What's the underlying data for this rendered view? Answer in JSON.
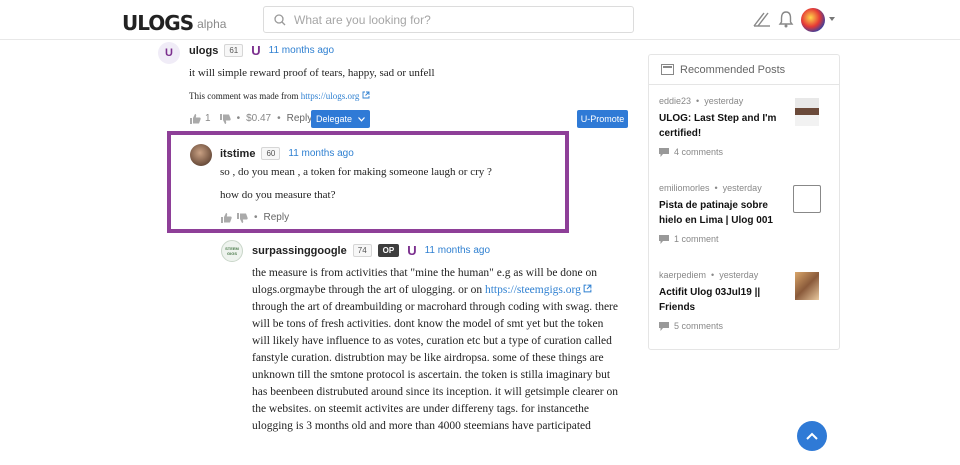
{
  "header": {
    "logo_text": "ULOGS",
    "logo_tag": "alpha",
    "search_placeholder": "What are you looking for?"
  },
  "comments": [
    {
      "author": "ulogs",
      "rep": "61",
      "time": "11 months ago",
      "text": "it will simple reward proof of tears, happy, sad or unfell",
      "made_from_prefix": "This comment was made from",
      "made_from_link": "https://ulogs.org",
      "votes": "1",
      "payout": "$0.47",
      "reply_label": "Reply",
      "delegate_label": "Delegate",
      "upromote_label": "U-Promote"
    },
    {
      "author": "itstime",
      "rep": "60",
      "time": "11 months ago",
      "line1": "so , do you mean , a token for making someone laugh or cry ?",
      "line2": "how do you measure that?",
      "reply_label": "Reply"
    },
    {
      "author": "surpassinggoogle",
      "rep": "74",
      "badge": "OP",
      "time": "11 months ago",
      "avatar_text": "STEEM GIGS",
      "para_1": "the measure is from activities that \"mine the human\" e.g as will be done on ulogs.orgmaybe through the art of ulogging. or on",
      "link": "https://steemgigs.org",
      "para_2": "through the art of dreambuilding or macrohard through coding with swag. there will be tons of fresh activities. dont know the model of smt yet but the token will likely have influence to as votes, curation etc but a type of curation called fanstyle curation. distrubtion may be like airdropsa. some of these things are unknown till the smtone protocol is ascertain. the token is stilla imaginary but has beenbeen distrubuted around since its inception. it will getsimple clearer on the websites. on steemit activites are under differeny tags. for instancethe ulogging is 3 months old and more than 4000 steemians have participated"
    }
  ],
  "sidebar": {
    "title": "Recommended Posts",
    "posts": [
      {
        "author": "eddie23",
        "time": "yesterday",
        "title": "ULOG: Last Step and I'm certified!",
        "comments": "4 comments"
      },
      {
        "author": "emiliomorles",
        "time": "yesterday",
        "title": "Pista de patinaje sobre hielo en Lima | Ulog 001",
        "comments": "1 comment"
      },
      {
        "author": "kaerpediem",
        "time": "yesterday",
        "title": "Actifit Ulog 03Jul19 || Friends",
        "comments": "5 comments"
      }
    ]
  },
  "colors": {
    "accent": "#2f7ad6",
    "highlight": "#8e3f98",
    "brand": "#7b2f8e"
  }
}
